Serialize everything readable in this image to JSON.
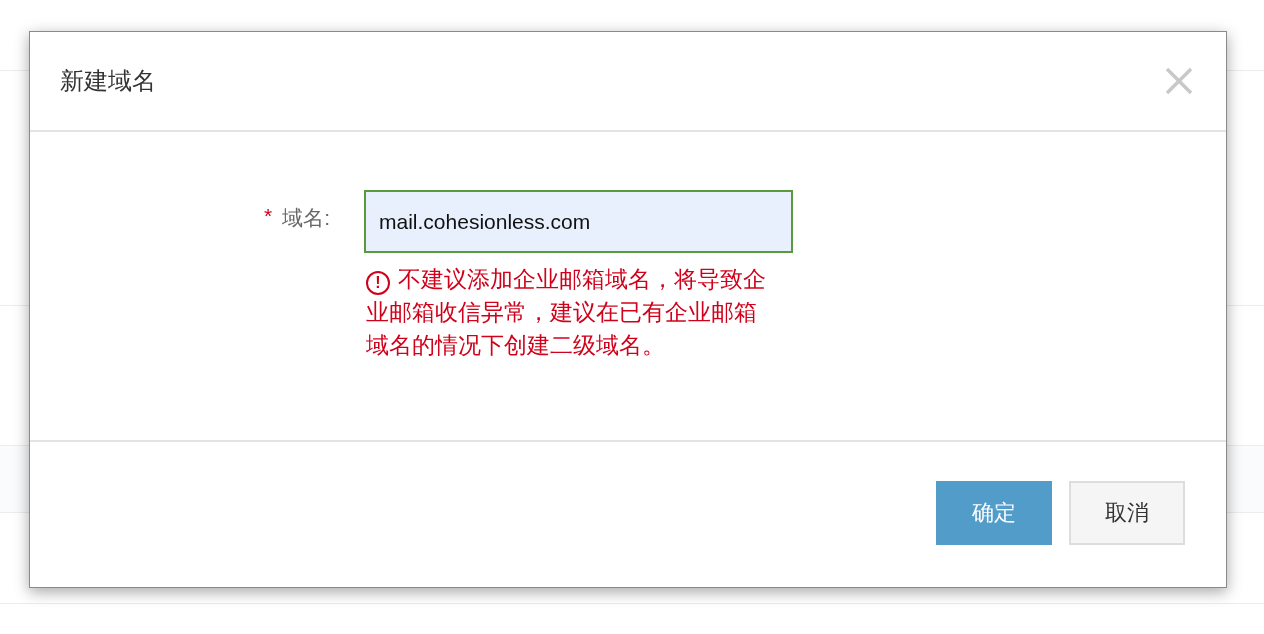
{
  "dialog": {
    "title": "新建域名",
    "field": {
      "required_mark": "*",
      "label": "域名:",
      "value": "mail.cohesionless.com",
      "error": {
        "icon": "!",
        "message": "不建议添加企业邮箱域名，将导致企业邮箱收信异常，建议在已有企业邮箱域名的情况下创建二级域名。"
      }
    },
    "buttons": [
      {
        "label": "确定",
        "kind": "primary"
      },
      {
        "label": "取消",
        "kind": "secondary"
      }
    ]
  }
}
